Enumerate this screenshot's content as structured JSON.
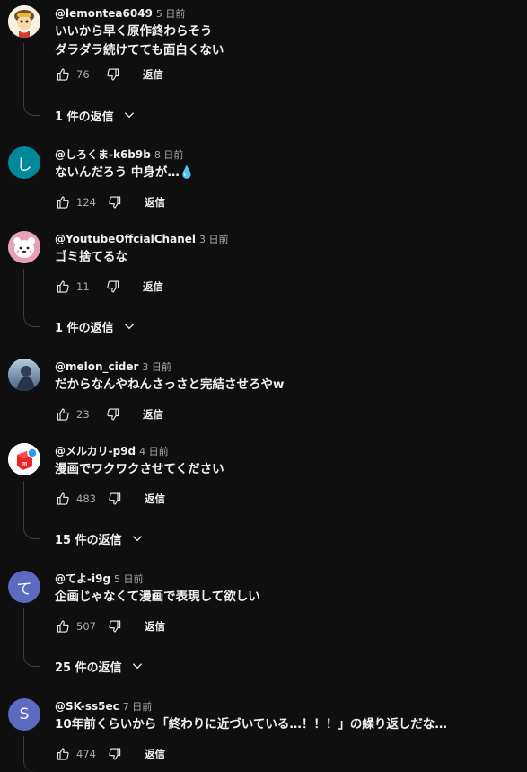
{
  "comments": [
    {
      "author": "@lemontea6049",
      "time": "5 日前",
      "text": "いいから早く原作終わらそう\nダラダラ続けてても面白くない",
      "likes": "76",
      "reply_label": "返信",
      "replies": "1 件の返信",
      "avatar_icon": "cartoon-character-avatar",
      "avatar_color": "#f4f1e6"
    },
    {
      "author": "@しろくま-k6b9b",
      "time": "8 日前",
      "text": "ないんだろう 中身が…💧",
      "likes": "124",
      "reply_label": "返信",
      "avatar_letter": "し",
      "avatar_color": "#00899a"
    },
    {
      "author": "@YoutubeOffcialChanel",
      "time": "3 日前",
      "text": "ゴミ捨てるな",
      "likes": "11",
      "reply_label": "返信",
      "replies": "1 件の返信",
      "avatar_icon": "white-bear-avatar",
      "avatar_color": "#e7a0b4"
    },
    {
      "author": "@melon_cider",
      "time": "3 日前",
      "text": "だからなんやねんさっさと完結させろやw",
      "likes": "23",
      "reply_label": "返信",
      "avatar_icon": "anime-character-avatar",
      "avatar_color": "#6f8fae"
    },
    {
      "author": "@メルカリ-p9d",
      "time": "4 日前",
      "text": "漫画でワクワクさせてください",
      "likes": "483",
      "reply_label": "返信",
      "replies": "15 件の返信",
      "avatar_icon": "mercari-logo-avatar",
      "avatar_color": "#ffffff"
    },
    {
      "author": "@てよ-i9g",
      "time": "5 日前",
      "text": "企画じゃなくて漫画で表現して欲しい",
      "likes": "507",
      "reply_label": "返信",
      "replies": "25 件の返信",
      "avatar_letter": "て",
      "avatar_color": "#5c6bc0"
    },
    {
      "author": "@SK-ss5ec",
      "time": "7 日前",
      "text": "10年前くらいから「終わりに近づいている…！！！」の繰り返しだな…",
      "likes": "474",
      "reply_label": "返信",
      "avatar_letter": "S",
      "avatar_color": "#5c6bc0"
    }
  ]
}
